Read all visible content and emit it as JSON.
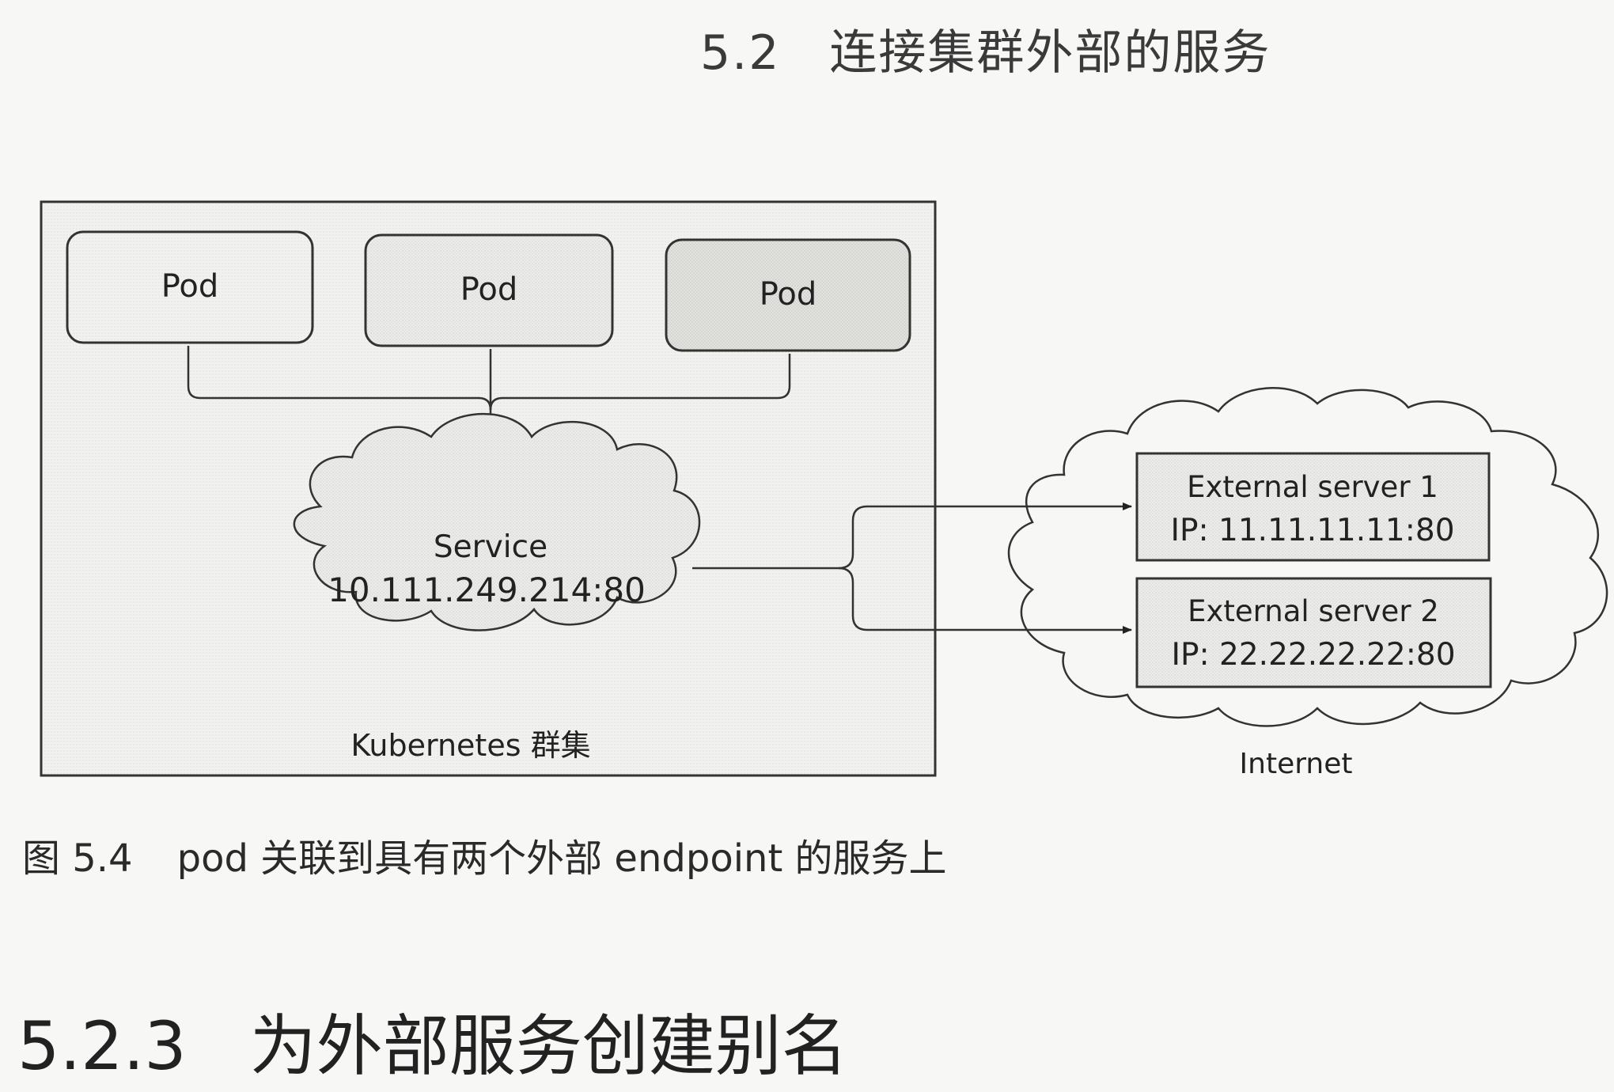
{
  "page_header": {
    "number": "5.2",
    "title": "连接集群外部的服务"
  },
  "figure": {
    "pods": [
      "Pod",
      "Pod",
      "Pod"
    ],
    "service": {
      "label": "Service",
      "address": "10.111.249.214:80"
    },
    "cluster_label": "Kubernetes 群集",
    "external_servers": [
      {
        "name": "External server 1",
        "ip": "IP: 11.11.11.11:80"
      },
      {
        "name": "External server 2",
        "ip": "IP: 22.22.22.22:80"
      }
    ],
    "internet_label": "Internet"
  },
  "caption": {
    "number": "图 5.4",
    "text": "pod 关联到具有两个外部 endpoint 的服务上"
  },
  "section": {
    "number": "5.2.3",
    "title": "为外部服务创建别名"
  }
}
